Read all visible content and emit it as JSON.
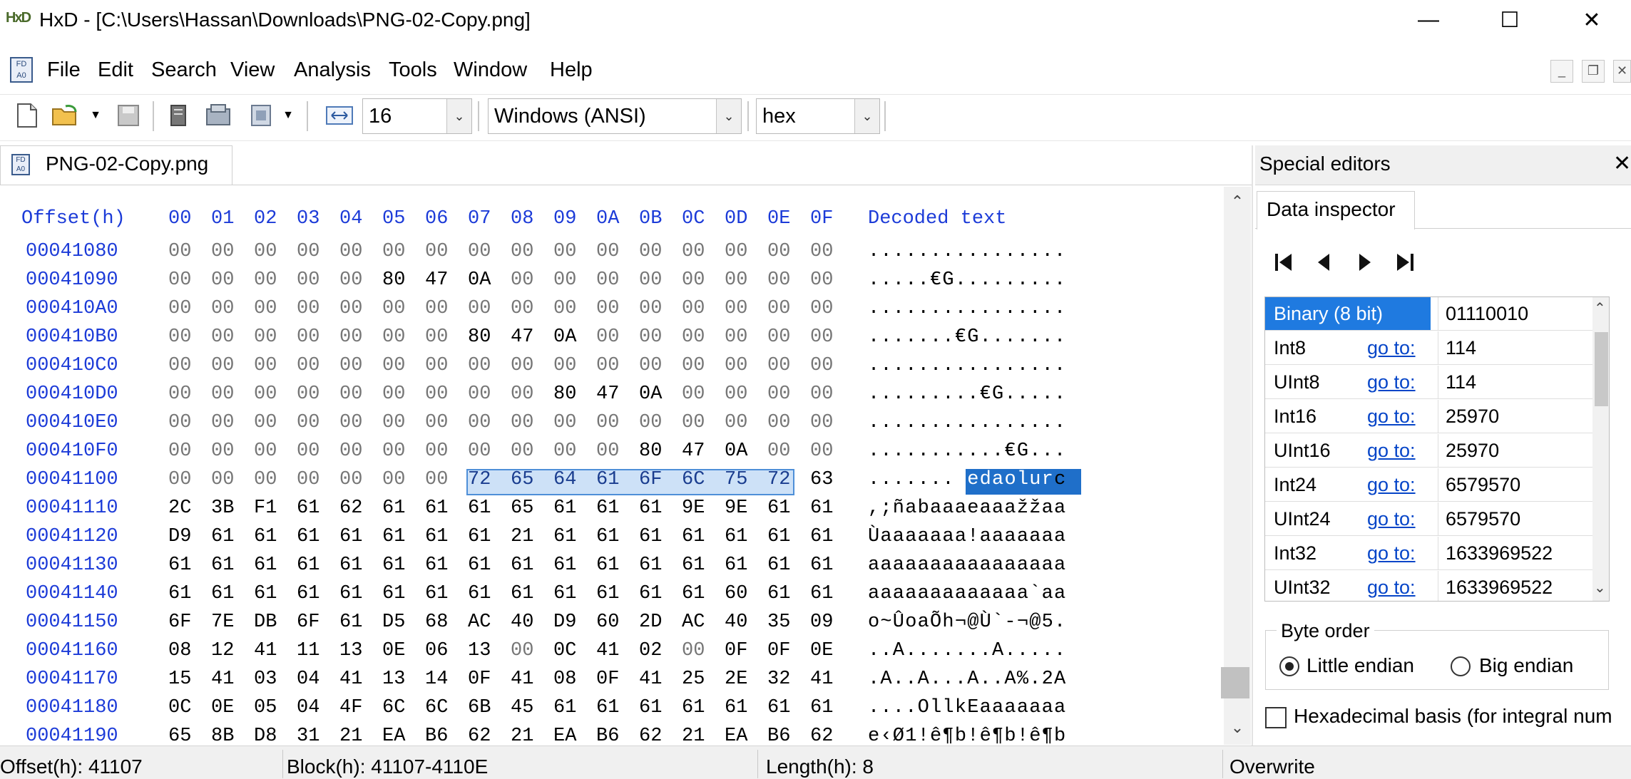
{
  "window": {
    "logo_text": "HxD",
    "title": "HxD - [C:\\Users\\Hassan\\Downloads\\PNG-02-Copy.png]",
    "controls": {
      "minimize": "—",
      "maximize": "☐",
      "close": "✕"
    }
  },
  "menu": {
    "items": [
      "File",
      "Edit",
      "Search",
      "View",
      "Analysis",
      "Tools",
      "Window",
      "Help"
    ],
    "icon_text": "FD\nA0"
  },
  "toolbar": {
    "bytes_per_row": "16",
    "charset": "Windows (ANSI)",
    "display_mode": "hex",
    "icons": [
      "new-file-icon",
      "open-file-icon",
      "save-icon",
      "file-tools-icon",
      "disk-icon",
      "ram-icon",
      "bytes-per-row-icon"
    ]
  },
  "tab": {
    "label": "PNG-02-Copy.png"
  },
  "hex": {
    "header_offset": "Offset(h)",
    "header_cols": [
      "00",
      "01",
      "02",
      "03",
      "04",
      "05",
      "06",
      "07",
      "08",
      "09",
      "0A",
      "0B",
      "0C",
      "0D",
      "0E",
      "0F"
    ],
    "header_decoded": "Decoded text",
    "rows": [
      {
        "offset": "00041080",
        "bytes": [
          "00",
          "00",
          "00",
          "00",
          "00",
          "00",
          "00",
          "00",
          "00",
          "00",
          "00",
          "00",
          "00",
          "00",
          "00",
          "00"
        ],
        "decoded": "................"
      },
      {
        "offset": "00041090",
        "bytes": [
          "00",
          "00",
          "00",
          "00",
          "00",
          "80",
          "47",
          "0A",
          "00",
          "00",
          "00",
          "00",
          "00",
          "00",
          "00",
          "00"
        ],
        "decoded": ".....€G........."
      },
      {
        "offset": "000410A0",
        "bytes": [
          "00",
          "00",
          "00",
          "00",
          "00",
          "00",
          "00",
          "00",
          "00",
          "00",
          "00",
          "00",
          "00",
          "00",
          "00",
          "00"
        ],
        "decoded": "................"
      },
      {
        "offset": "000410B0",
        "bytes": [
          "00",
          "00",
          "00",
          "00",
          "00",
          "00",
          "00",
          "80",
          "47",
          "0A",
          "00",
          "00",
          "00",
          "00",
          "00",
          "00"
        ],
        "decoded": ".......€G......."
      },
      {
        "offset": "000410C0",
        "bytes": [
          "00",
          "00",
          "00",
          "00",
          "00",
          "00",
          "00",
          "00",
          "00",
          "00",
          "00",
          "00",
          "00",
          "00",
          "00",
          "00"
        ],
        "decoded": "................"
      },
      {
        "offset": "000410D0",
        "bytes": [
          "00",
          "00",
          "00",
          "00",
          "00",
          "00",
          "00",
          "00",
          "00",
          "80",
          "47",
          "0A",
          "00",
          "00",
          "00",
          "00"
        ],
        "decoded": ".........€G....."
      },
      {
        "offset": "000410E0",
        "bytes": [
          "00",
          "00",
          "00",
          "00",
          "00",
          "00",
          "00",
          "00",
          "00",
          "00",
          "00",
          "00",
          "00",
          "00",
          "00",
          "00"
        ],
        "decoded": "................"
      },
      {
        "offset": "000410F0",
        "bytes": [
          "00",
          "00",
          "00",
          "00",
          "00",
          "00",
          "00",
          "00",
          "00",
          "00",
          "00",
          "80",
          "47",
          "0A",
          "00",
          "00"
        ],
        "decoded": "...........€G..."
      },
      {
        "offset": "00041100",
        "bytes": [
          "00",
          "00",
          "00",
          "00",
          "00",
          "00",
          "00",
          "72",
          "65",
          "64",
          "61",
          "6F",
          "6C",
          "75",
          "72",
          "63"
        ],
        "decoded": ".......redaolurc"
      },
      {
        "offset": "00041110",
        "bytes": [
          "2C",
          "3B",
          "F1",
          "61",
          "62",
          "61",
          "61",
          "61",
          "65",
          "61",
          "61",
          "61",
          "9E",
          "9E",
          "61",
          "61"
        ],
        "decoded": ",;ñabaaaeaaažžaa"
      },
      {
        "offset": "00041120",
        "bytes": [
          "D9",
          "61",
          "61",
          "61",
          "61",
          "61",
          "61",
          "61",
          "21",
          "61",
          "61",
          "61",
          "61",
          "61",
          "61",
          "61"
        ],
        "decoded": "Ùaaaaaaa!aaaaaaa"
      },
      {
        "offset": "00041130",
        "bytes": [
          "61",
          "61",
          "61",
          "61",
          "61",
          "61",
          "61",
          "61",
          "61",
          "61",
          "61",
          "61",
          "61",
          "61",
          "61",
          "61"
        ],
        "decoded": "aaaaaaaaaaaaaaaa"
      },
      {
        "offset": "00041140",
        "bytes": [
          "61",
          "61",
          "61",
          "61",
          "61",
          "61",
          "61",
          "61",
          "61",
          "61",
          "61",
          "61",
          "61",
          "60",
          "61",
          "61"
        ],
        "decoded": "aaaaaaaaaaaaa`aa"
      },
      {
        "offset": "00041150",
        "bytes": [
          "6F",
          "7E",
          "DB",
          "6F",
          "61",
          "D5",
          "68",
          "AC",
          "40",
          "D9",
          "60",
          "2D",
          "AC",
          "40",
          "35",
          "09"
        ],
        "decoded": "o~ÛoaÕh¬@Ù`-¬@5."
      },
      {
        "offset": "00041160",
        "bytes": [
          "08",
          "12",
          "41",
          "11",
          "13",
          "0E",
          "06",
          "13",
          "00",
          "0C",
          "41",
          "02",
          "00",
          "0F",
          "0F",
          "0E"
        ],
        "decoded": "..A.......A....."
      },
      {
        "offset": "00041170",
        "bytes": [
          "15",
          "41",
          "03",
          "04",
          "41",
          "13",
          "14",
          "0F",
          "41",
          "08",
          "0F",
          "41",
          "25",
          "2E",
          "32",
          "41"
        ],
        "decoded": ".A..A...A..A%.2A"
      },
      {
        "offset": "00041180",
        "bytes": [
          "0C",
          "0E",
          "05",
          "04",
          "4F",
          "6C",
          "6C",
          "6B",
          "45",
          "61",
          "61",
          "61",
          "61",
          "61",
          "61",
          "61"
        ],
        "decoded": "....OllkEaaaaaaa"
      },
      {
        "offset": "00041190",
        "bytes": [
          "65",
          "8B",
          "D8",
          "31",
          "21",
          "EA",
          "B6",
          "62",
          "21",
          "EA",
          "B6",
          "62",
          "21",
          "EA",
          "B6",
          "62"
        ],
        "decoded": "e‹Ø1!ê¶b!ê¶b!ê¶b"
      }
    ]
  },
  "special_editors": {
    "title": "Special editors",
    "close": "✕",
    "tab": "Data inspector",
    "goto_label": "go to:",
    "rows": [
      {
        "name": "Binary (8 bit)",
        "value": "01110010",
        "goto": false
      },
      {
        "name": "Int8",
        "value": "114",
        "goto": true
      },
      {
        "name": "UInt8",
        "value": "114",
        "goto": true
      },
      {
        "name": "Int16",
        "value": "25970",
        "goto": true
      },
      {
        "name": "UInt16",
        "value": "25970",
        "goto": true
      },
      {
        "name": "Int24",
        "value": "6579570",
        "goto": true
      },
      {
        "name": "UInt24",
        "value": "6579570",
        "goto": true
      },
      {
        "name": "Int32",
        "value": "1633969522",
        "goto": true
      },
      {
        "name": "UInt32",
        "value": "1633969522",
        "goto": true
      }
    ],
    "byte_order": {
      "label": "Byte order",
      "little": "Little endian",
      "big": "Big endian",
      "selected": "little"
    },
    "hex_basis": "Hexadecimal basis (for integral num"
  },
  "status": {
    "offset": "Offset(h): 41107",
    "block": "Block(h): 41107-4110E",
    "length": "Length(h): 8",
    "mode": "Overwrite"
  },
  "colors": {
    "offset_blue": "#1c3bd8",
    "selection": "#3c87d6",
    "link": "#0645c8"
  }
}
